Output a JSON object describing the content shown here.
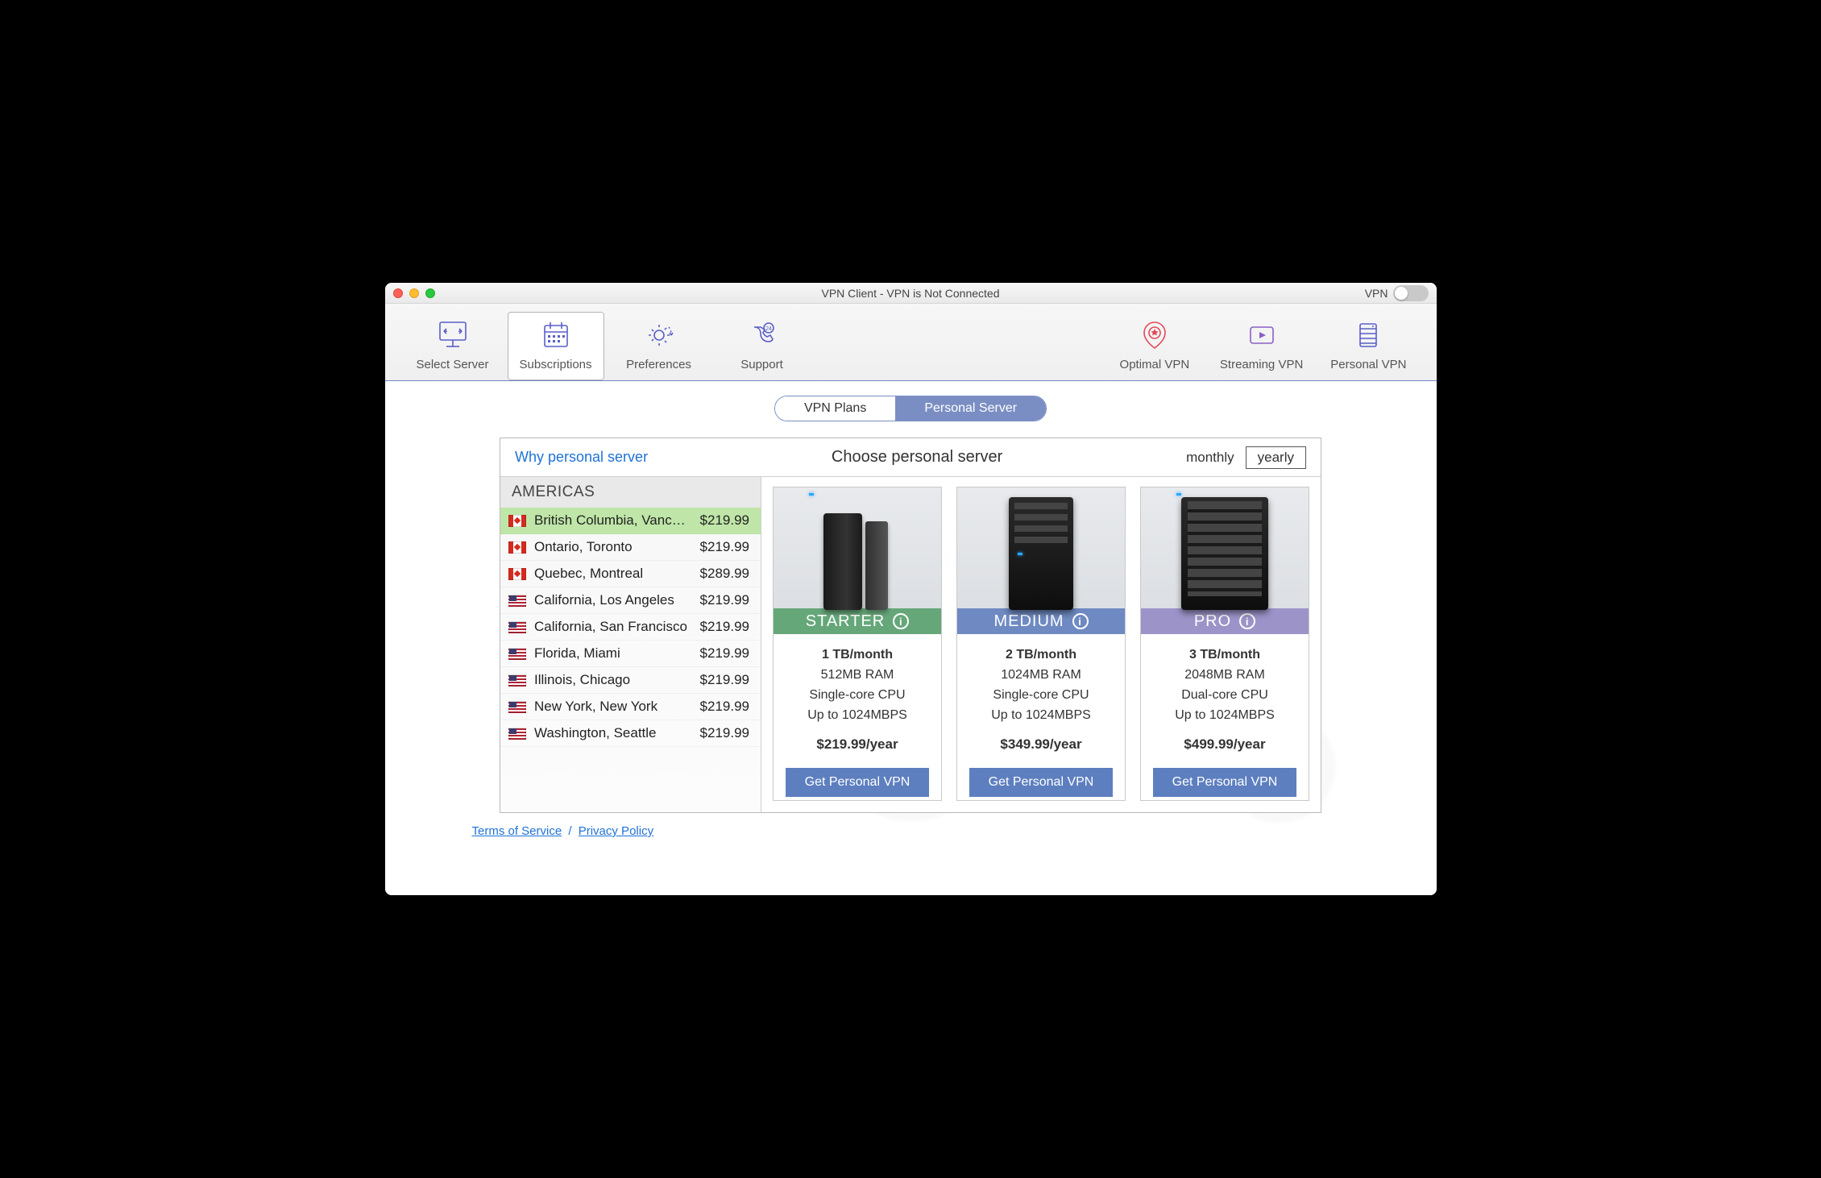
{
  "window": {
    "title": "VPN Client - VPN is Not Connected",
    "vpn_label": "VPN",
    "vpn_toggle_on": false
  },
  "toolbar": {
    "items": [
      {
        "id": "select-server",
        "label": "Select Server"
      },
      {
        "id": "subscriptions",
        "label": "Subscriptions",
        "active": true
      },
      {
        "id": "preferences",
        "label": "Preferences"
      },
      {
        "id": "support",
        "label": "Support"
      }
    ],
    "right_items": [
      {
        "id": "optimal-vpn",
        "label": "Optimal VPN"
      },
      {
        "id": "streaming-vpn",
        "label": "Streaming VPN"
      },
      {
        "id": "personal-vpn",
        "label": "Personal VPN"
      }
    ]
  },
  "segments": {
    "left": "VPN Plans",
    "right": "Personal Server",
    "active": "right"
  },
  "panel": {
    "why_link": "Why personal server",
    "choose_title": "Choose personal server",
    "period": {
      "monthly": "monthly",
      "yearly": "yearly",
      "active": "yearly"
    }
  },
  "regions": {
    "header": "AMERICAS",
    "items": [
      {
        "flag": "ca",
        "name": "British Columbia, Vanc…",
        "price": "$219.99",
        "selected": true
      },
      {
        "flag": "ca",
        "name": "Ontario, Toronto",
        "price": "$219.99"
      },
      {
        "flag": "ca",
        "name": "Quebec, Montreal",
        "price": "$289.99"
      },
      {
        "flag": "us",
        "name": "California, Los Angeles",
        "price": "$219.99"
      },
      {
        "flag": "us",
        "name": "California, San Francisco",
        "price": "$219.99"
      },
      {
        "flag": "us",
        "name": "Florida, Miami",
        "price": "$219.99"
      },
      {
        "flag": "us",
        "name": "Illinois, Chicago",
        "price": "$219.99"
      },
      {
        "flag": "us",
        "name": "New York, New York",
        "price": "$219.99"
      },
      {
        "flag": "us",
        "name": "Washington, Seattle",
        "price": "$219.99"
      }
    ]
  },
  "plans": [
    {
      "id": "starter",
      "tier": "STARTER",
      "tier_class": "tier-starter",
      "img_class": "starter",
      "specs": {
        "bw": "1 TB/month",
        "ram": "512MB RAM",
        "cpu": "Single-core CPU",
        "speed": "Up to 1024MBPS"
      },
      "price": "$219.99/year",
      "button": "Get Personal VPN"
    },
    {
      "id": "medium",
      "tier": "MEDIUM",
      "tier_class": "tier-medium",
      "img_class": "medium",
      "specs": {
        "bw": "2 TB/month",
        "ram": "1024MB RAM",
        "cpu": "Single-core CPU",
        "speed": "Up to 1024MBPS"
      },
      "price": "$349.99/year",
      "button": "Get Personal VPN"
    },
    {
      "id": "pro",
      "tier": "PRO",
      "tier_class": "tier-pro",
      "img_class": "pro",
      "specs": {
        "bw": "3 TB/month",
        "ram": "2048MB RAM",
        "cpu": "Dual-core CPU",
        "speed": "Up to 1024MBPS"
      },
      "price": "$499.99/year",
      "button": "Get Personal VPN"
    }
  ],
  "footer": {
    "tos": "Terms of Service",
    "privacy": "Privacy Policy",
    "sep": "/"
  },
  "colors": {
    "accent": "#5d7fbf",
    "link": "#1f72d6",
    "starter": "#66a77a",
    "medium": "#6f8ac2",
    "pro": "#9c94c8",
    "selected_row": "#bfe6a8"
  }
}
